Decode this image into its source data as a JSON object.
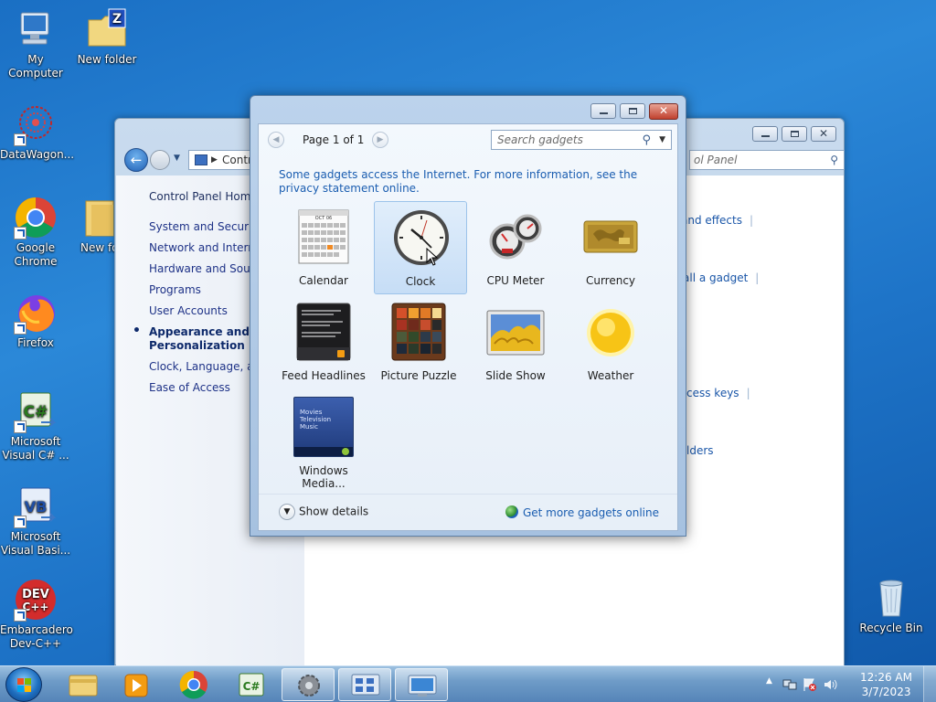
{
  "desktop": {
    "icons": [
      {
        "label": "My Computer",
        "icon": "computer-icon"
      },
      {
        "label": "New folder",
        "icon": "folder-zip-icon"
      },
      {
        "label": "DataWagon...",
        "icon": "datawagon-icon"
      },
      {
        "label": "Google Chrome",
        "icon": "chrome-icon"
      },
      {
        "label": "New fo",
        "icon": "folder-icon"
      },
      {
        "label": "Firefox",
        "icon": "firefox-icon"
      },
      {
        "label": "Microsoft Visual C# ...",
        "icon": "csharp-icon"
      },
      {
        "label": "Microsoft Visual Basi...",
        "icon": "vb-icon"
      },
      {
        "label": "Embarcadero Dev-C++",
        "icon": "devcpp-icon"
      },
      {
        "label": "Recycle Bin",
        "icon": "recycle-bin-icon"
      }
    ]
  },
  "control_panel": {
    "address_text": "Contr",
    "search_text": "ol Panel",
    "sidebar": [
      {
        "label": "Control Panel Home"
      },
      {
        "label": "System and Security"
      },
      {
        "label": "Network and Internet"
      },
      {
        "label": "Hardware and Sound"
      },
      {
        "label": "Programs"
      },
      {
        "label": "User Accounts"
      },
      {
        "label": "Appearance and Personalization",
        "active": true
      },
      {
        "label": "Clock, Language, and"
      },
      {
        "label": "Ease of Access"
      }
    ],
    "links": [
      {
        "label": "and effects"
      },
      {
        "label": "all a gadget"
      },
      {
        "label": "cess keys"
      },
      {
        "label": "lders"
      }
    ]
  },
  "gadget_gallery": {
    "page_label": "Page 1 of 1",
    "search_placeholder": "Search gadgets",
    "note": "Some gadgets access the Internet.  For more information, see the privacy statement online.",
    "gadgets": [
      {
        "label": "Calendar",
        "calendar_month": "OCT 06"
      },
      {
        "label": "Clock",
        "selected": true
      },
      {
        "label": "CPU Meter"
      },
      {
        "label": "Currency"
      },
      {
        "label": "Feed Headlines"
      },
      {
        "label": "Picture Puzzle"
      },
      {
        "label": "Slide Show"
      },
      {
        "label": "Weather"
      },
      {
        "label": "Windows Media...",
        "media_lines": [
          "Movies",
          "Television",
          "Music"
        ]
      }
    ],
    "show_details": "Show details",
    "get_more": "Get more gadgets online"
  },
  "taskbar": {
    "time": "12:26 AM",
    "date": "3/7/2023",
    "buttons": [
      {
        "name": "explorer-taskbar-button"
      },
      {
        "name": "media-player-taskbar-button"
      },
      {
        "name": "chrome-taskbar-button"
      },
      {
        "name": "csharp-taskbar-button"
      },
      {
        "name": "settings-taskbar-button"
      },
      {
        "name": "control-panel-taskbar-button"
      },
      {
        "name": "gadgets-taskbar-button"
      }
    ]
  }
}
